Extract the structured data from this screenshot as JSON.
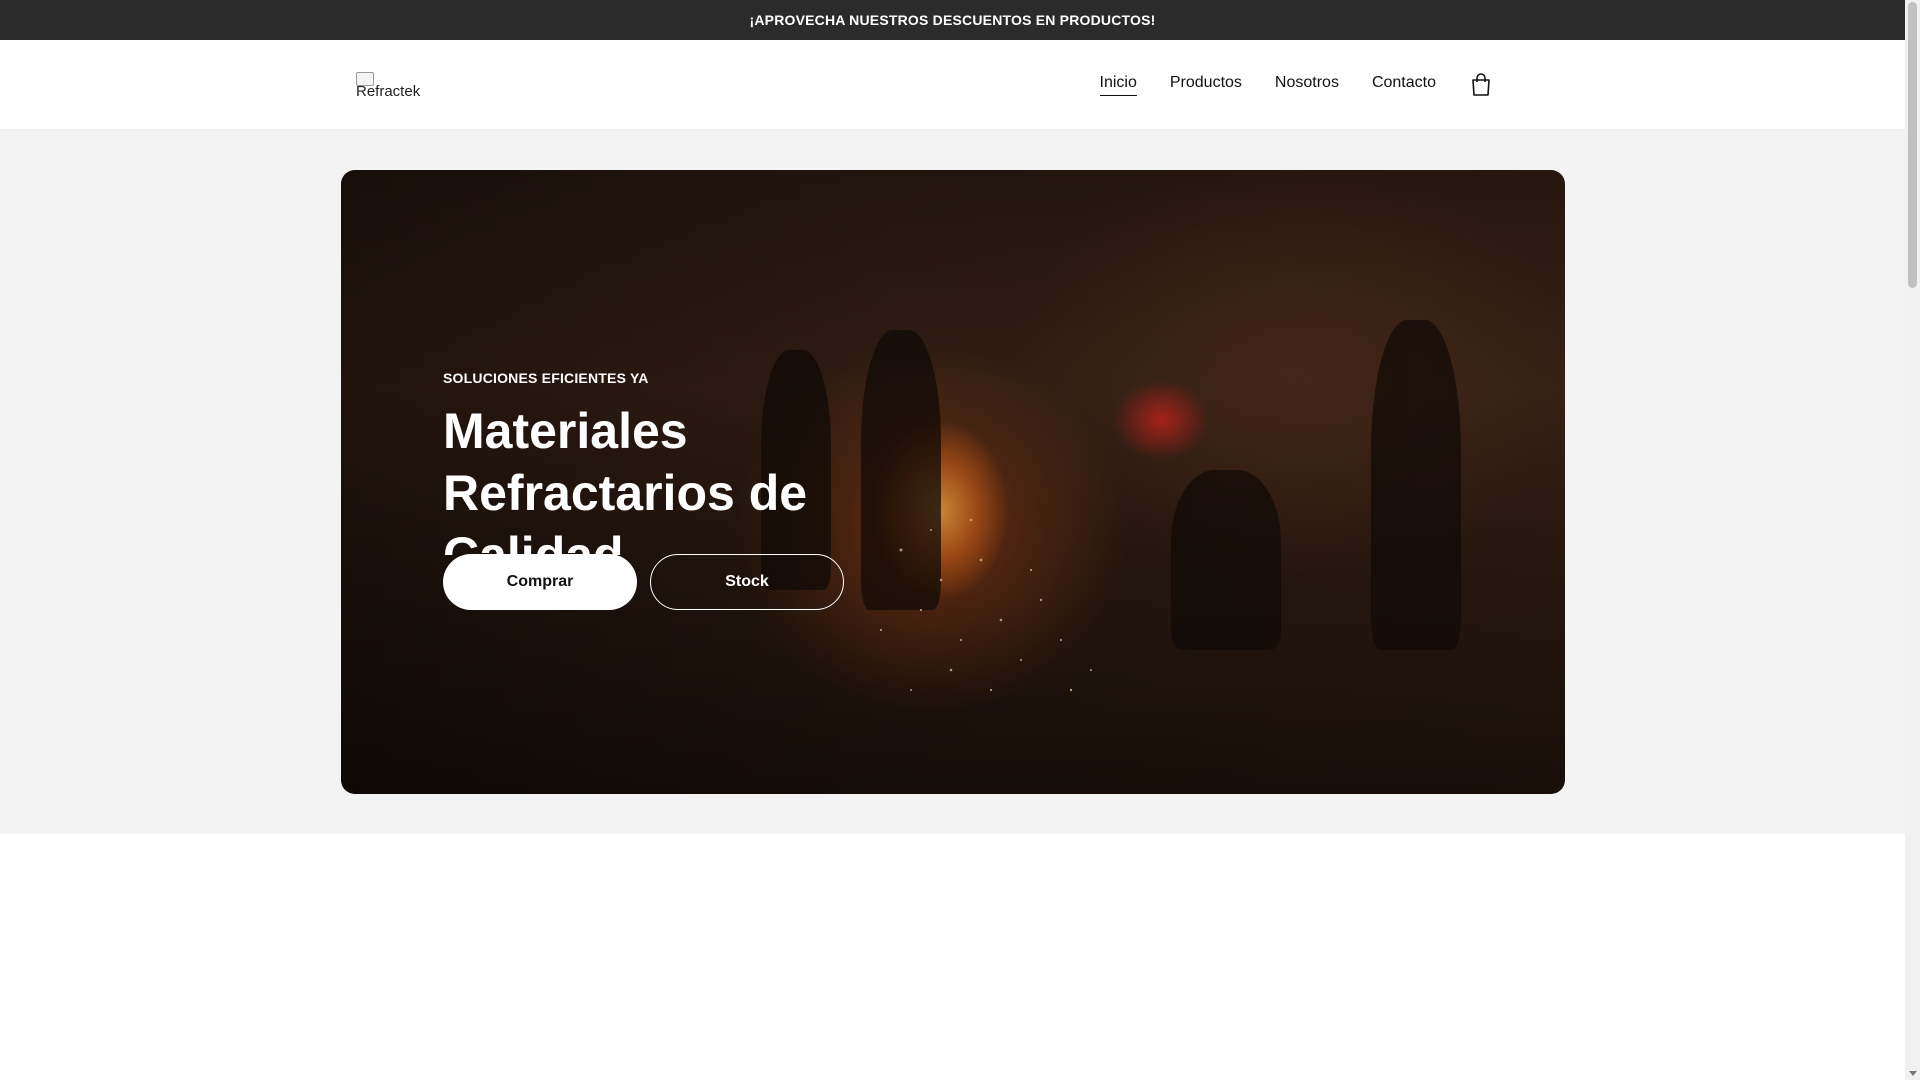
{
  "announcement": {
    "text": "¡APROVECHA NUESTROS DESCUENTOS EN PRODUCTOS!"
  },
  "header": {
    "logo_alt": "Refractek",
    "nav": [
      {
        "label": "Inicio",
        "active": true
      },
      {
        "label": "Productos",
        "active": false
      },
      {
        "label": "Nosotros",
        "active": false
      },
      {
        "label": "Contacto",
        "active": false
      }
    ],
    "cart_icon": "shopping-bag-icon"
  },
  "hero": {
    "eyebrow": "SOLUCIONES EFICIENTES YA",
    "title": "Materiales Refractarios de Calidad",
    "buttons": {
      "primary": "Comprar",
      "secondary": "Stock"
    },
    "background_image": "foundry-workers-molten-metal-sparks"
  },
  "colors": {
    "announcement_bg": "#2b2b2b",
    "hero_section_bg": "#f3f3f3",
    "primary_button_bg": "#ffffff"
  }
}
